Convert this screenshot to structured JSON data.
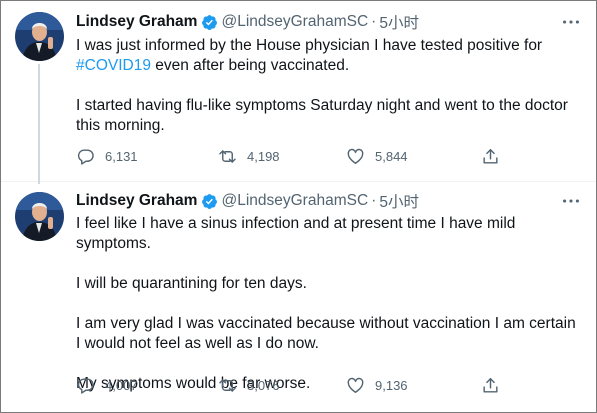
{
  "tweets": [
    {
      "author_name": "Lindsey Graham",
      "handle": "@LindseyGrahamSC",
      "separator": "·",
      "time": "5小时",
      "text_before_hashtag": "I was just informed by the House physician I have tested positive for",
      "hashtag": "#COVID19",
      "text_after_hashtag": " even after being vaccinated.",
      "paragraph2": "I started having flu-like symptoms Saturday night and went to the doctor this morning.",
      "reply_count": "6,131",
      "retweet_count": "4,198",
      "like_count": "5,844"
    },
    {
      "author_name": "Lindsey Graham",
      "handle": "@LindseyGrahamSC",
      "separator": "·",
      "time": "5小时",
      "paragraph1": "I feel like I have a sinus infection and at present time I have mild symptoms.",
      "paragraph2": "I will be quarantining for ten days.",
      "paragraph3": "I am very glad I was vaccinated because without vaccination I am certain I would not feel as well as I do now.",
      "paragraph4": "My symptoms would be far worse.",
      "reply_count": "4,007",
      "retweet_count": "3,076",
      "like_count": "9,136"
    }
  ],
  "colors": {
    "text": "#0f1419",
    "secondary": "#536471",
    "link": "#1d9bf0",
    "verified": "#1d9bf0",
    "thread_line": "#cfd9de"
  },
  "icons": [
    "verified-badge-icon",
    "more-icon",
    "reply-icon",
    "retweet-icon",
    "like-icon",
    "share-icon"
  ]
}
